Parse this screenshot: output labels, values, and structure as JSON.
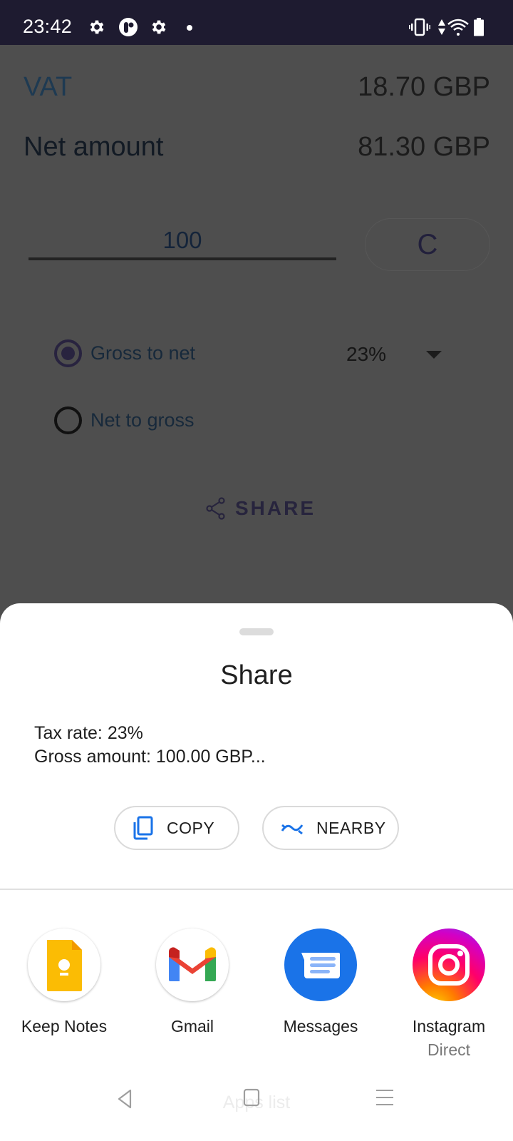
{
  "status_bar": {
    "time": "23:42",
    "left_icons": [
      "settings-icon",
      "app-p-icon",
      "settings-icon",
      "notification-dot-icon"
    ],
    "right_icons": [
      "vibrate-icon",
      "data-arrows-icon",
      "wifi-icon",
      "battery-icon"
    ]
  },
  "app": {
    "vat_label": "VAT",
    "vat_value": "18.70 GBP",
    "net_label": "Net amount",
    "net_value": "81.30 GBP",
    "amount_input": "100",
    "clear_label": "C",
    "modes": [
      {
        "label": "Gross to net",
        "checked": true
      },
      {
        "label": "Net to gross",
        "checked": false
      }
    ],
    "tax_rate": "23%",
    "share_label": "SHARE"
  },
  "sheet": {
    "title": "Share",
    "preview_lines": [
      "Tax rate: 23%",
      "Gross amount: 100.00 GBP..."
    ],
    "actions": [
      {
        "label": "COPY",
        "icon": "copy-icon"
      },
      {
        "label": "NEARBY",
        "icon": "nearby-share-icon"
      }
    ],
    "targets": [
      {
        "label": "Keep Notes",
        "sub": "",
        "icon": "keep-notes-icon"
      },
      {
        "label": "Gmail",
        "sub": "",
        "icon": "gmail-icon"
      },
      {
        "label": "Messages",
        "sub": "",
        "icon": "messages-icon"
      },
      {
        "label": "Instagram",
        "sub": "Direct",
        "icon": "instagram-icon"
      }
    ],
    "accent_color": "#1a73e8"
  },
  "nav_bar": {
    "overlay_text": "Apps list",
    "buttons": [
      "back-icon",
      "home-icon",
      "menu-icon"
    ]
  }
}
